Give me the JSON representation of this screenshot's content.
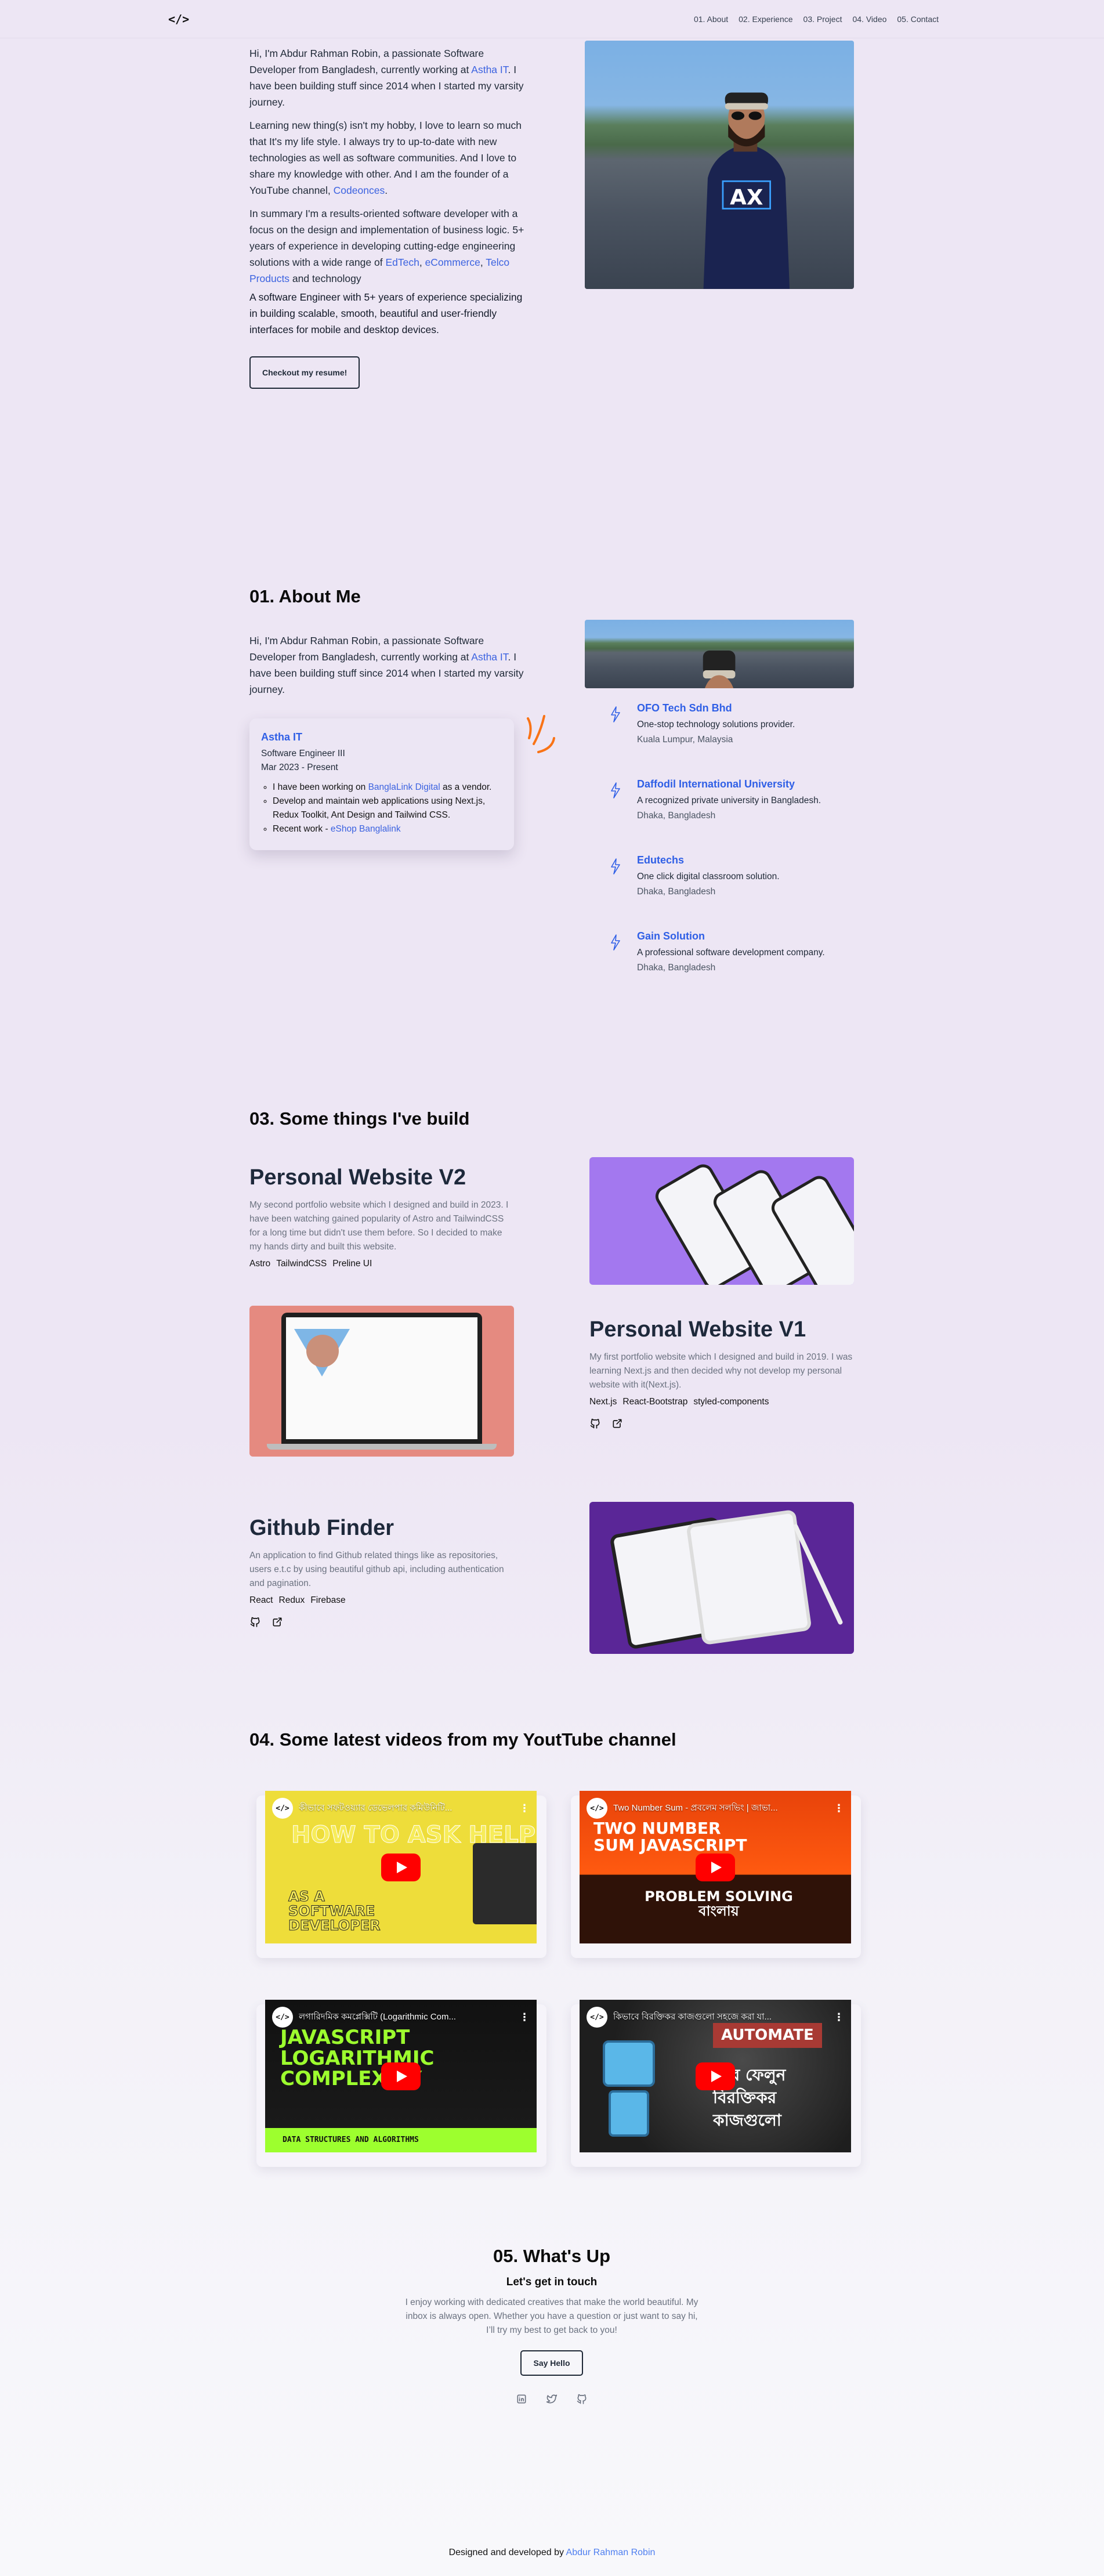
{
  "nav": {
    "logo": "</>",
    "links": [
      "01. About",
      "02. Experience",
      "03. Project",
      "04. Video",
      "05. Contact"
    ]
  },
  "hero": {
    "p1_pre": "Hi, I'm Abdur Rahman Robin, a passionate Software Developer from Bangladesh, currently working at ",
    "p1_link": "Astha IT",
    "p1_post": ". I have been building stuff since 2014 when I started my varsity journey.",
    "p2_pre": "Learning new thing(s) isn't my hobby, I love to learn so much that It's my life style. I always try to up-to-date with new technologies as well as software communities. And I love to share my knowledge with other. And I am the founder of a YouTube channel, ",
    "p2_link": "Codeonces",
    "p2_post": ".",
    "p3_pre": "In summary I'm a results-oriented software developer with a focus on the design and implementation of business logic. 5+ years of experience in developing cutting-edge engineering solutions with a wide range of ",
    "p3_links": [
      "EdTech",
      "eCommerce",
      "Telco Products"
    ],
    "p3_post": " and technology",
    "p4": "A software Engineer with 5+ years of experience specializing in building scalable, smooth, beautiful and user-friendly interfaces for mobile and desktop devices.",
    "resume_button": "Checkout my resume!",
    "photo_alt": "Portrait photo of Abdur Rahman Robin"
  },
  "about": {
    "title": "01. About Me",
    "p1_pre": "Hi, I'm Abdur Rahman Robin, a passionate Software Developer from Bangladesh, currently working at ",
    "p1_link": "Astha IT",
    "p1_post": ". I have been building stuff since 2014 when I started my varsity journey."
  },
  "experience": {
    "current": {
      "company": "Astha IT",
      "role": "Software Engineer III",
      "period": "Mar 2023 - Present",
      "bullets": [
        {
          "pre": "I have been working on ",
          "link": "BanglaLink Digital",
          "post": " as a vendor."
        },
        {
          "pre": "Develop and maintain web applications using Next.js, Redux Toolkit, Ant Design and Tailwind CSS.",
          "link": "",
          "post": ""
        },
        {
          "pre": "Recent work - ",
          "link": "eShop Banglalink",
          "post": ""
        }
      ]
    },
    "timeline": [
      {
        "name": "OFO Tech Sdn Bhd",
        "desc": "One-stop technology solutions provider.",
        "location": "Kuala Lumpur, Malaysia"
      },
      {
        "name": "Daffodil International University",
        "desc": "A recognized private university in Bangladesh.",
        "location": "Dhaka, Bangladesh"
      },
      {
        "name": "Edutechs",
        "desc": "One click digital classroom solution.",
        "location": "Dhaka, Bangladesh"
      },
      {
        "name": "Gain Solution",
        "desc": "A professional software development company.",
        "location": "Dhaka, Bangladesh"
      }
    ]
  },
  "projects": {
    "title": "03. Some things I've build",
    "items": [
      {
        "name": "Personal Website V2",
        "desc": "My second portfolio website which I designed and build in 2023. I have been watching gained popularity of Astro and TailwindCSS for a long time but didn't use them before. So I decided to make my hands dirty and built this website.",
        "tags": [
          "Astro",
          "TailwindCSS",
          "Preline UI"
        ]
      },
      {
        "name": "Personal Website V1",
        "desc": "My first portfolio website which I designed and build in 2019. I was learning Next.js and then decided why not develop my personal website with it(Next.js).",
        "tags": [
          "Next.js",
          "React-Bootstrap",
          "styled-components"
        ]
      },
      {
        "name": "Github Finder",
        "desc": "An application to find Github related things like as repositories, users e.t.c by using beautiful github api, including authentication and pagination.",
        "tags": [
          "React",
          "Redux",
          "Firebase"
        ]
      }
    ]
  },
  "videos": {
    "title": "04. Some latest videos from my YoutTube channel",
    "channel_avatar": "</>",
    "items": [
      {
        "title": "কীভাবে সফটওয়্যার ডেভেলপার কমিউনিটি...",
        "caption_top": "HOW TO ASK HELP",
        "caption_bottom": "AS A SOFTWARE DEVELOPER"
      },
      {
        "title": "Two Number Sum - প্রবলেম সলভিং | জাভা...",
        "caption_top": "TWO NUMBER SUM JAVASCRIPT",
        "caption_bottom": "PROBLEM SOLVING বাংলায়"
      },
      {
        "title": "লগারিদমিক কমপ্লেক্সিটি (Logarithmic Com...",
        "caption_top": "JAVASCRIPT LOGARITHMIC COMPLEXITY",
        "caption_bottom": "DATA STRUCTURES AND ALGORITHMS"
      },
      {
        "title": "কিভাবে বিরক্তিকর কাজগুলো সহজে করা যা...",
        "caption_top": "AUTOMATE",
        "caption_bottom": "করে ফেলুন বিরক্তিকর কাজগুলো"
      }
    ]
  },
  "contact": {
    "title": "05. What's Up",
    "subtitle": "Let's get in touch",
    "text": "I enjoy working with dedicated creatives that make the world beautiful. My inbox is always open. Whether you have a question or just want to say hi, I’ll try my best to get back to you!",
    "button": "Say Hello",
    "socials": [
      "linkedin",
      "twitter",
      "github"
    ]
  },
  "footer": {
    "pre": "Designed and developed by ",
    "link": "Abdur Rahman Robin"
  },
  "colors": {
    "accent": "#3b62e0",
    "background": "#ede6f4",
    "squiggle": "#f97316"
  }
}
